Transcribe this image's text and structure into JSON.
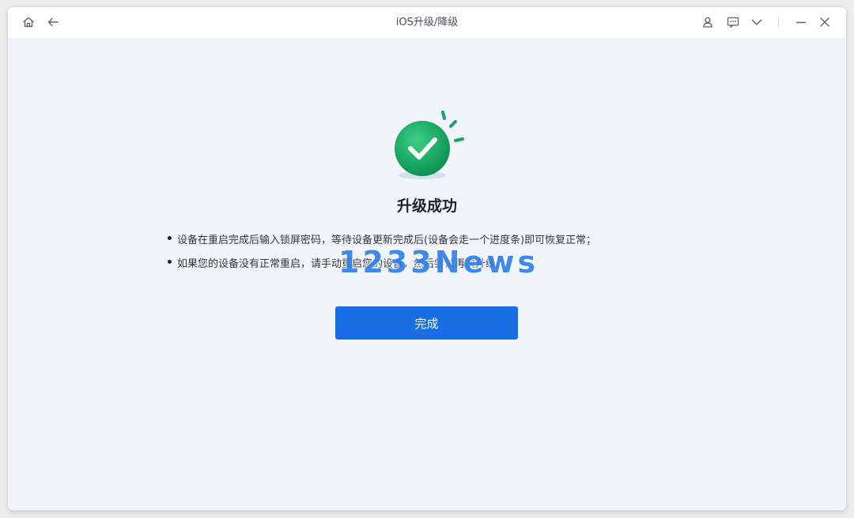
{
  "window": {
    "title": "iOS升级/降级"
  },
  "titlebar": {
    "left_icons": [
      "home-icon",
      "back-arrow-icon"
    ],
    "right_icons": [
      "user-icon",
      "feedback-icon",
      "chevron-down-icon",
      "minimize-icon",
      "close-icon"
    ]
  },
  "result": {
    "icon": "check-circle-icon",
    "accent_color": "#1aa360",
    "headline": "升级成功",
    "tips": [
      "设备在重启完成后输入锁屏密码，等待设备更新完成后(设备会走一个进度条)即可恢复正常；",
      "如果您的设备没有正常重启，请手动重启您的设备，然后尝试再次升级。"
    ]
  },
  "actions": {
    "done_label": "完成",
    "button_color": "#1a6ee3"
  },
  "watermark": {
    "text": "1233News"
  }
}
